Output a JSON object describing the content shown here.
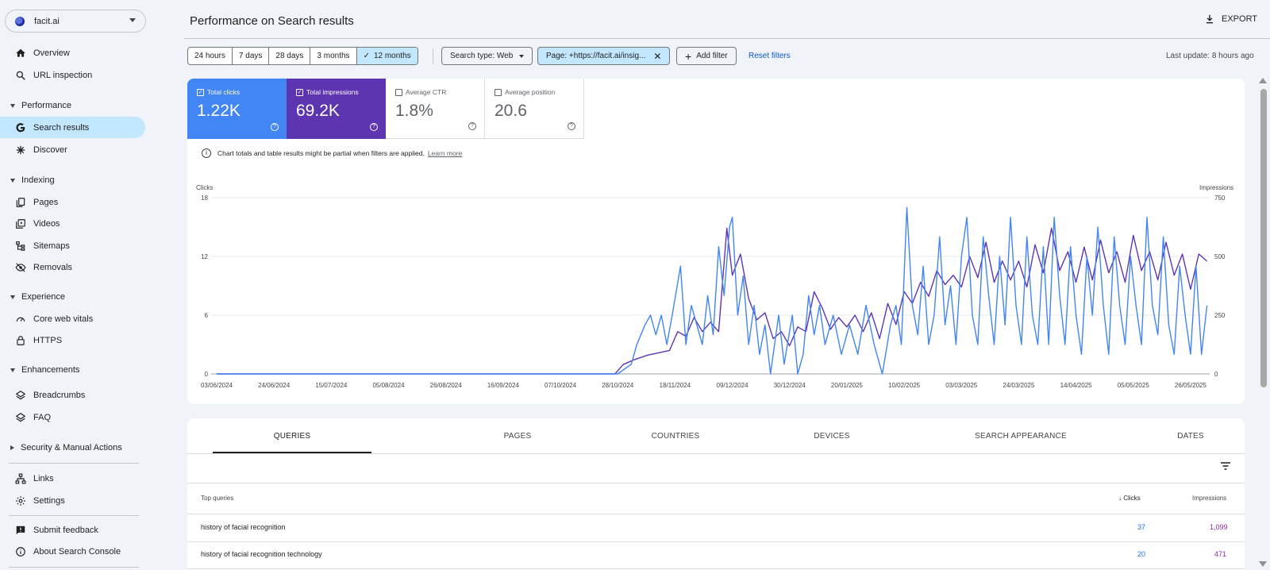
{
  "property": {
    "name": "facit.ai"
  },
  "sidebar": {
    "overview": "Overview",
    "url_inspection": "URL inspection",
    "performance": "Performance",
    "search_results": "Search results",
    "discover": "Discover",
    "indexing": "Indexing",
    "pages": "Pages",
    "videos": "Videos",
    "sitemaps": "Sitemaps",
    "removals": "Removals",
    "experience": "Experience",
    "core_web_vitals": "Core web vitals",
    "https": "HTTPS",
    "enhancements": "Enhancements",
    "breadcrumbs": "Breadcrumbs",
    "faq": "FAQ",
    "security": "Security & Manual Actions",
    "links": "Links",
    "settings": "Settings",
    "submit_feedback": "Submit feedback",
    "about": "About Search Console"
  },
  "header": {
    "title": "Performance on Search results",
    "export": "EXPORT"
  },
  "filters": {
    "ranges": [
      "24 hours",
      "7 days",
      "28 days",
      "3 months",
      "12 months"
    ],
    "selected_range": "12 months",
    "search_type": "Search type: Web",
    "page_filter": "Page: +https://facit.ai/insig...",
    "add_filter": "Add filter",
    "reset": "Reset filters",
    "last_update": "Last update: 8 hours ago"
  },
  "metrics": {
    "clicks": {
      "label": "Total clicks",
      "value": "1.22K"
    },
    "impressions": {
      "label": "Total impressions",
      "value": "69.2K"
    },
    "ctr": {
      "label": "Average CTR",
      "value": "1.8%"
    },
    "position": {
      "label": "Average position",
      "value": "20.6"
    }
  },
  "notice": {
    "text": "Chart totals and table results might be partial when filters are applied.",
    "link": "Learn more"
  },
  "chart_data": {
    "type": "line",
    "ylabel_left": "Clicks",
    "ylabel_right": "Impressions",
    "yticks_left": [
      "18",
      "12",
      "6",
      "0"
    ],
    "yticks_right": [
      "750",
      "500",
      "250",
      "0"
    ],
    "ylim_left": [
      0,
      18
    ],
    "ylim_right": [
      0,
      750
    ],
    "xticks": [
      "03/06/2024",
      "24/06/2024",
      "15/07/2024",
      "05/08/2024",
      "26/08/2024",
      "16/09/2024",
      "07/10/2024",
      "28/10/2024",
      "18/11/2024",
      "09/12/2024",
      "30/12/2024",
      "20/01/2025",
      "10/02/2025",
      "03/03/2025",
      "24/03/2025",
      "14/04/2025",
      "05/05/2025",
      "26/05/2025"
    ],
    "grid": true,
    "series": [
      {
        "name": "Clicks",
        "color": "#4285f4",
        "axis": "left",
        "points": [
          [
            "2024-06-03",
            0
          ],
          [
            "2024-10-28",
            0
          ],
          [
            "2024-11-02",
            1
          ],
          [
            "2024-11-04",
            3
          ],
          [
            "2024-11-07",
            5
          ],
          [
            "2024-11-09",
            6
          ],
          [
            "2024-11-11",
            4
          ],
          [
            "2024-11-13",
            6
          ],
          [
            "2024-11-15",
            3
          ],
          [
            "2024-11-17",
            6
          ],
          [
            "2024-11-20",
            11
          ],
          [
            "2024-11-22",
            3
          ],
          [
            "2024-11-24",
            7
          ],
          [
            "2024-11-26",
            5
          ],
          [
            "2024-11-28",
            3
          ],
          [
            "2024-11-30",
            8
          ],
          [
            "2024-12-02",
            4
          ],
          [
            "2024-12-04",
            13
          ],
          [
            "2024-12-06",
            8
          ],
          [
            "2024-12-08",
            15
          ],
          [
            "2024-12-09",
            16
          ],
          [
            "2024-12-11",
            6
          ],
          [
            "2024-12-13",
            10
          ],
          [
            "2024-12-15",
            3
          ],
          [
            "2024-12-17",
            7
          ],
          [
            "2024-12-19",
            2
          ],
          [
            "2024-12-21",
            5
          ],
          [
            "2024-12-23",
            0
          ],
          [
            "2024-12-26",
            6
          ],
          [
            "2024-12-28",
            1
          ],
          [
            "2024-12-31",
            6
          ],
          [
            "2025-01-02",
            0
          ],
          [
            "2025-01-04",
            2
          ],
          [
            "2025-01-06",
            8
          ],
          [
            "2025-01-08",
            4
          ],
          [
            "2025-01-10",
            7
          ],
          [
            "2025-01-12",
            3
          ],
          [
            "2025-01-15",
            6
          ],
          [
            "2025-01-18",
            2
          ],
          [
            "2025-01-21",
            5
          ],
          [
            "2025-01-24",
            2
          ],
          [
            "2025-01-27",
            7
          ],
          [
            "2025-01-30",
            3
          ],
          [
            "2025-02-02",
            0
          ],
          [
            "2025-02-05",
            5
          ],
          [
            "2025-02-07",
            7
          ],
          [
            "2025-02-09",
            3
          ],
          [
            "2025-02-11",
            17
          ],
          [
            "2025-02-13",
            7
          ],
          [
            "2025-02-15",
            4
          ],
          [
            "2025-02-17",
            11
          ],
          [
            "2025-02-19",
            3
          ],
          [
            "2025-02-21",
            6
          ],
          [
            "2025-02-23",
            14
          ],
          [
            "2025-02-25",
            5
          ],
          [
            "2025-02-27",
            9
          ],
          [
            "2025-03-01",
            3
          ],
          [
            "2025-03-03",
            12
          ],
          [
            "2025-03-05",
            16
          ],
          [
            "2025-03-07",
            6
          ],
          [
            "2025-03-09",
            3
          ],
          [
            "2025-03-11",
            14
          ],
          [
            "2025-03-13",
            8
          ],
          [
            "2025-03-15",
            3
          ],
          [
            "2025-03-17",
            12
          ],
          [
            "2025-03-19",
            5
          ],
          [
            "2025-03-21",
            16
          ],
          [
            "2025-03-23",
            7
          ],
          [
            "2025-03-25",
            3
          ],
          [
            "2025-03-27",
            14
          ],
          [
            "2025-03-29",
            6
          ],
          [
            "2025-03-31",
            3
          ],
          [
            "2025-04-02",
            13
          ],
          [
            "2025-04-04",
            3
          ],
          [
            "2025-04-06",
            16
          ],
          [
            "2025-04-08",
            8
          ],
          [
            "2025-04-10",
            3
          ],
          [
            "2025-04-12",
            13
          ],
          [
            "2025-04-14",
            6
          ],
          [
            "2025-04-16",
            2
          ],
          [
            "2025-04-18",
            12
          ],
          [
            "2025-04-20",
            6
          ],
          [
            "2025-04-22",
            15
          ],
          [
            "2025-04-24",
            7
          ],
          [
            "2025-04-26",
            2
          ],
          [
            "2025-04-28",
            14
          ],
          [
            "2025-04-30",
            7
          ],
          [
            "2025-05-02",
            3
          ],
          [
            "2025-05-04",
            12
          ],
          [
            "2025-05-06",
            7
          ],
          [
            "2025-05-08",
            3
          ],
          [
            "2025-05-10",
            16
          ],
          [
            "2025-05-12",
            7
          ],
          [
            "2025-05-14",
            4
          ],
          [
            "2025-05-16",
            14
          ],
          [
            "2025-05-18",
            5
          ],
          [
            "2025-05-20",
            2
          ],
          [
            "2025-05-22",
            11
          ],
          [
            "2025-05-24",
            6
          ],
          [
            "2025-05-26",
            2
          ],
          [
            "2025-05-28",
            11
          ],
          [
            "2025-05-30",
            2
          ],
          [
            "2025-06-01",
            7
          ]
        ]
      },
      {
        "name": "Impressions",
        "color": "#5e35b1",
        "axis": "right",
        "points": [
          [
            "2024-06-03",
            0
          ],
          [
            "2024-10-27",
            0
          ],
          [
            "2024-10-30",
            40
          ],
          [
            "2024-11-03",
            60
          ],
          [
            "2024-11-08",
            80
          ],
          [
            "2024-11-12",
            90
          ],
          [
            "2024-11-16",
            100
          ],
          [
            "2024-11-19",
            180
          ],
          [
            "2024-11-22",
            160
          ],
          [
            "2024-11-25",
            240
          ],
          [
            "2024-11-28",
            180
          ],
          [
            "2024-12-01",
            220
          ],
          [
            "2024-12-04",
            180
          ],
          [
            "2024-12-07",
            620
          ],
          [
            "2024-12-09",
            420
          ],
          [
            "2024-12-12",
            510
          ],
          [
            "2024-12-15",
            320
          ],
          [
            "2024-12-18",
            230
          ],
          [
            "2024-12-21",
            260
          ],
          [
            "2024-12-24",
            150
          ],
          [
            "2024-12-27",
            180
          ],
          [
            "2024-12-30",
            120
          ],
          [
            "2025-01-02",
            200
          ],
          [
            "2025-01-05",
            180
          ],
          [
            "2025-01-08",
            350
          ],
          [
            "2025-01-11",
            280
          ],
          [
            "2025-01-14",
            190
          ],
          [
            "2025-01-17",
            240
          ],
          [
            "2025-01-20",
            200
          ],
          [
            "2025-01-23",
            250
          ],
          [
            "2025-01-26",
            180
          ],
          [
            "2025-01-29",
            260
          ],
          [
            "2025-02-01",
            150
          ],
          [
            "2025-02-04",
            300
          ],
          [
            "2025-02-07",
            210
          ],
          [
            "2025-02-10",
            350
          ],
          [
            "2025-02-13",
            300
          ],
          [
            "2025-02-16",
            390
          ],
          [
            "2025-02-19",
            330
          ],
          [
            "2025-02-22",
            440
          ],
          [
            "2025-02-25",
            380
          ],
          [
            "2025-02-28",
            420
          ],
          [
            "2025-03-03",
            370
          ],
          [
            "2025-03-06",
            500
          ],
          [
            "2025-03-09",
            410
          ],
          [
            "2025-03-12",
            560
          ],
          [
            "2025-03-15",
            390
          ],
          [
            "2025-03-18",
            480
          ],
          [
            "2025-03-21",
            400
          ],
          [
            "2025-03-24",
            480
          ],
          [
            "2025-03-27",
            370
          ],
          [
            "2025-03-30",
            550
          ],
          [
            "2025-04-02",
            430
          ],
          [
            "2025-04-05",
            620
          ],
          [
            "2025-04-08",
            440
          ],
          [
            "2025-04-11",
            520
          ],
          [
            "2025-04-14",
            390
          ],
          [
            "2025-04-17",
            540
          ],
          [
            "2025-04-20",
            400
          ],
          [
            "2025-04-23",
            570
          ],
          [
            "2025-04-26",
            430
          ],
          [
            "2025-04-29",
            520
          ],
          [
            "2025-05-02",
            390
          ],
          [
            "2025-05-05",
            590
          ],
          [
            "2025-05-08",
            440
          ],
          [
            "2025-05-11",
            520
          ],
          [
            "2025-05-14",
            400
          ],
          [
            "2025-05-17",
            560
          ],
          [
            "2025-05-20",
            420
          ],
          [
            "2025-05-23",
            510
          ],
          [
            "2025-05-26",
            360
          ],
          [
            "2025-05-29",
            510
          ],
          [
            "2025-06-01",
            480
          ]
        ]
      }
    ]
  },
  "tabs": [
    "QUERIES",
    "PAGES",
    "COUNTRIES",
    "DEVICES",
    "SEARCH APPEARANCE",
    "DATES"
  ],
  "table": {
    "headers": {
      "query": "Top queries",
      "clicks": "Clicks",
      "impressions": "Impressions"
    },
    "rows": [
      {
        "query": "history of facial recognition",
        "clicks": "37",
        "impressions": "1,099"
      },
      {
        "query": "history of facial recognition technology",
        "clicks": "20",
        "impressions": "471"
      }
    ]
  },
  "colors": {
    "clicks": "#4285f4",
    "impressions": "#5e35b1",
    "accent": "#c2e7ff",
    "link": "#0b57d0"
  }
}
